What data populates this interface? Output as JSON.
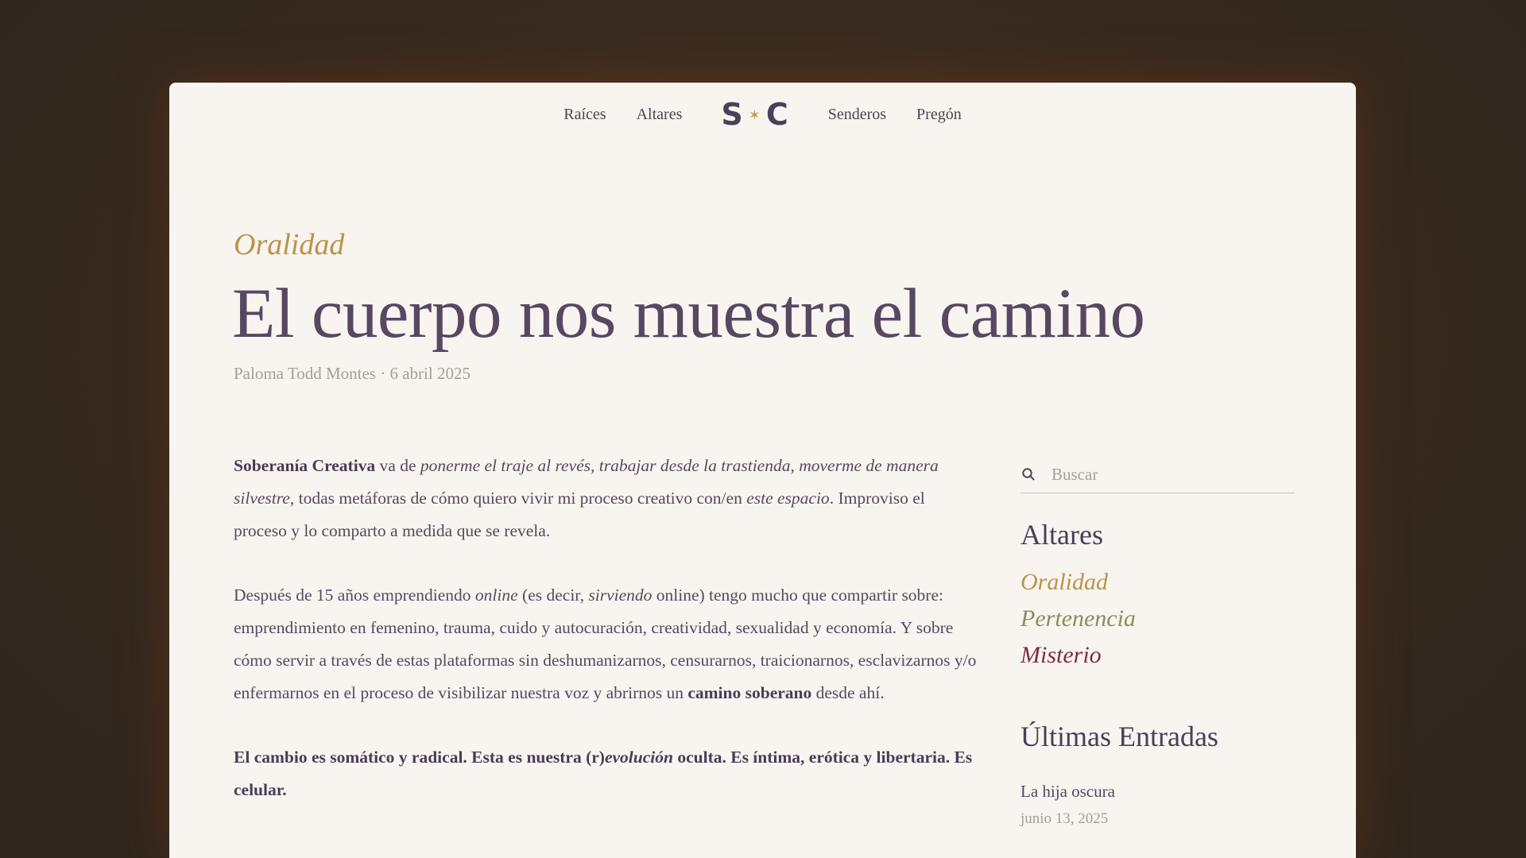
{
  "nav": {
    "left": [
      "Raíces",
      "Altares"
    ],
    "logo": {
      "left": "S",
      "star": "✶",
      "right": "C"
    },
    "right": [
      "Senderos",
      "Pregón"
    ]
  },
  "post": {
    "category": "Oralidad",
    "title": "El cuerpo nos muestra el camino",
    "meta": "Paloma Todd Montes · 6 abril 2025"
  },
  "article": {
    "p1": {
      "b1": "Soberanía Creativa",
      "t1": " va de ",
      "i1": "ponerme el traje al revés",
      "t2": ", ",
      "i2": "trabajar desde la trastienda",
      "t3": ", ",
      "i3": "moverme de manera silvestre",
      "t4": ", todas metáforas de cómo quiero vivir mi proceso creativo con/en ",
      "i4": "este espacio",
      "t5": ". Improviso el proceso y lo comparto a medida que se revela."
    },
    "p2": {
      "t1": "Después de 15 años emprendiendo ",
      "i1": "online",
      "t2": " (es decir, ",
      "i2": "sirviendo",
      "t3": " online) tengo mucho que compartir sobre: emprendimiento en femenino, trauma, cuido y autocuración, creatividad, sexualidad y economía. Y sobre cómo servir a través de estas plataformas sin deshumanizarnos, censurarnos, traicionarnos, esclavizarnos y/o enfermarnos en el proceso de visibilizar nuestra voz y abrirnos un ",
      "b1": "camino soberano",
      "t4": " desde ahí."
    },
    "p3": {
      "b1": "El cambio es somático y radical. Esta es nuestra (r)",
      "bi1": "evolución",
      "b2": " oculta. Es íntima, erótica y libertaria. Es celular."
    }
  },
  "sidebar": {
    "search_placeholder": "Buscar",
    "altares_heading": "Altares",
    "altares": [
      {
        "label": "Oralidad",
        "color": "#b99449"
      },
      {
        "label": "Pertenencia",
        "color": "#8c8b5c"
      },
      {
        "label": "Misterio",
        "color": "#7a2f3f"
      }
    ],
    "ultimas_heading": "Últimas Entradas",
    "entry": {
      "title": "La hija oscura",
      "date": "junio 13, 2025"
    }
  },
  "icons": {
    "search": "search-icon",
    "logo_star": "star-icon"
  },
  "colors": {
    "background": "#35291f",
    "card": "#f8f4ef",
    "accent": "#b99449",
    "text": "#574862"
  }
}
